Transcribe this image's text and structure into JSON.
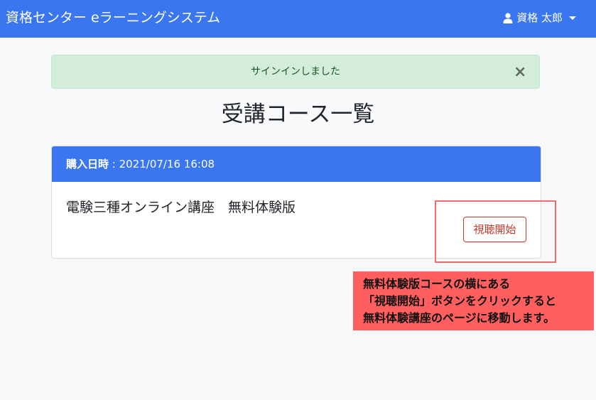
{
  "navbar": {
    "brand": "資格センター eラーニングシステム",
    "user_name": "資格 太郎"
  },
  "alert": {
    "message": "サインインしました",
    "close_label": "×"
  },
  "page": {
    "title": "受講コース一覧"
  },
  "course_card": {
    "purchase_label": "購入日時",
    "purchase_sep": " : ",
    "purchase_datetime": "2021/07/16 16:08",
    "course_title": "電験三種オンライン講座",
    "course_variant": "無料体験版",
    "start_button": "視聴開始"
  },
  "annotation": {
    "lines": [
      "無料体験版コースの横にある",
      "「視聴開始」ボタンをクリックすると",
      "無料体験講座のページに移動します。"
    ]
  },
  "colors": {
    "navbar": "#3a76f0",
    "alert_bg": "#d4edda",
    "button_accent": "#c0392b",
    "callout_bg": "#ff5f5f"
  },
  "icons": {
    "user": "user-icon",
    "dropdown": "caret-down-icon"
  }
}
